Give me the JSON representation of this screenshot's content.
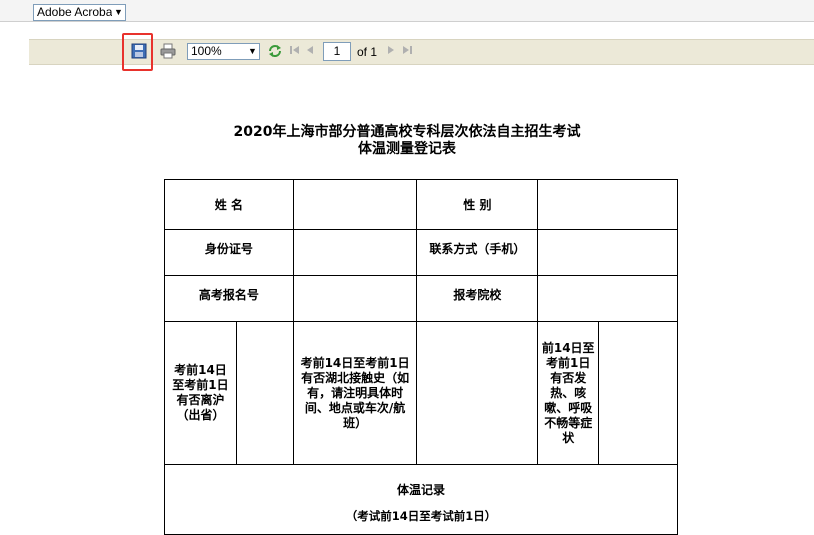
{
  "toolbar": {
    "renderer_select": "Adobe Acroba",
    "zoom_select": "100%",
    "page_number": "1",
    "page_count_label": "of 1"
  },
  "colors": {
    "highlight": "#e8322c",
    "toolbar_bg": "#ece9d8"
  },
  "document": {
    "title_line1": "2020年上海市部分普通高校专科层次依法自主招生考试",
    "title_line2": "体温测量登记表",
    "form": {
      "name_label": "姓 名",
      "gender_label": "性 别",
      "id_label": "身份证号",
      "contact_label": "联系方式（手机）",
      "exam_number_label": "高考报名号",
      "college_label": "报考院校",
      "left_shanghai_label": "考前14日至考前1日有否离沪（出省）",
      "hubei_contact_label": "考前14日至考前1日有否湖北接触史（如有，请注明具体时间、地点或车次/航班）",
      "symptoms_label": "前14日至考前1日有否发热、咳嗽、呼吸不畅等症状",
      "temp_record_label": "体温记录",
      "temp_record_sub": "（考试前14日至考试前1日）"
    }
  }
}
